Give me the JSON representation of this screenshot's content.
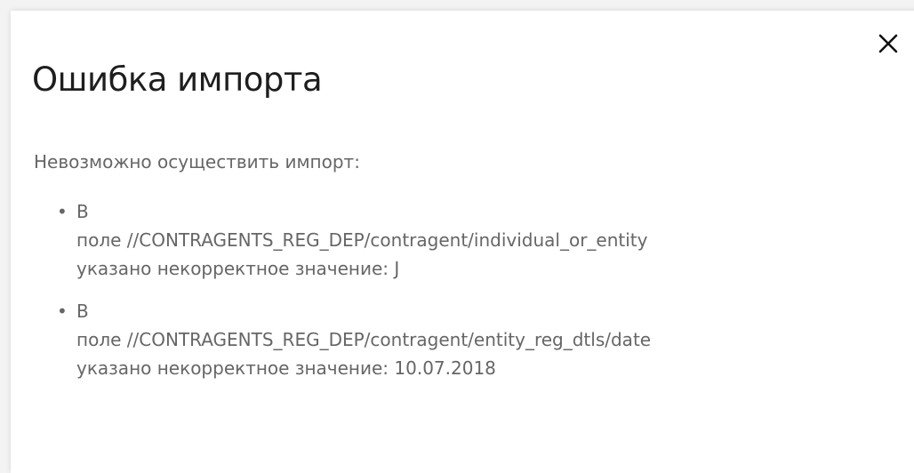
{
  "dialog": {
    "title": "Ошибка импорта",
    "intro": "Невозможно осуществить импорт:",
    "close_icon": "close-icon",
    "errors": [
      {
        "line1": "В",
        "line2": "поле //CONTRAGENTS_REG_DEP/contragent/individual_or_entity",
        "line3": "указано некорректное значение: J"
      },
      {
        "line1": "В",
        "line2": "поле //CONTRAGENTS_REG_DEP/contragent/entity_reg_dtls/date",
        "line3": "указано некорректное значение: 10.07.2018"
      }
    ]
  },
  "colors": {
    "title": "#1e1e1e",
    "text": "#666666",
    "background": "#ffffff"
  }
}
